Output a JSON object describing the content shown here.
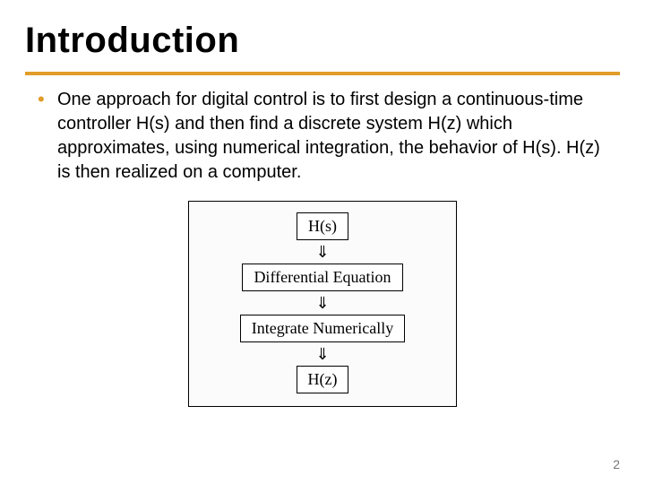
{
  "title": "Introduction",
  "bullets": [
    "One approach for digital control is to first design a continuous-time controller H(s) and then find a discrete system H(z) which approximates, using numerical integration, the behavior of H(s). H(z) is then realized on a computer."
  ],
  "diagram": {
    "steps": [
      "H(s)",
      "Differential Equation",
      "Integrate Numerically",
      "H(z)"
    ],
    "arrow": "⇓"
  },
  "page_number": "2"
}
